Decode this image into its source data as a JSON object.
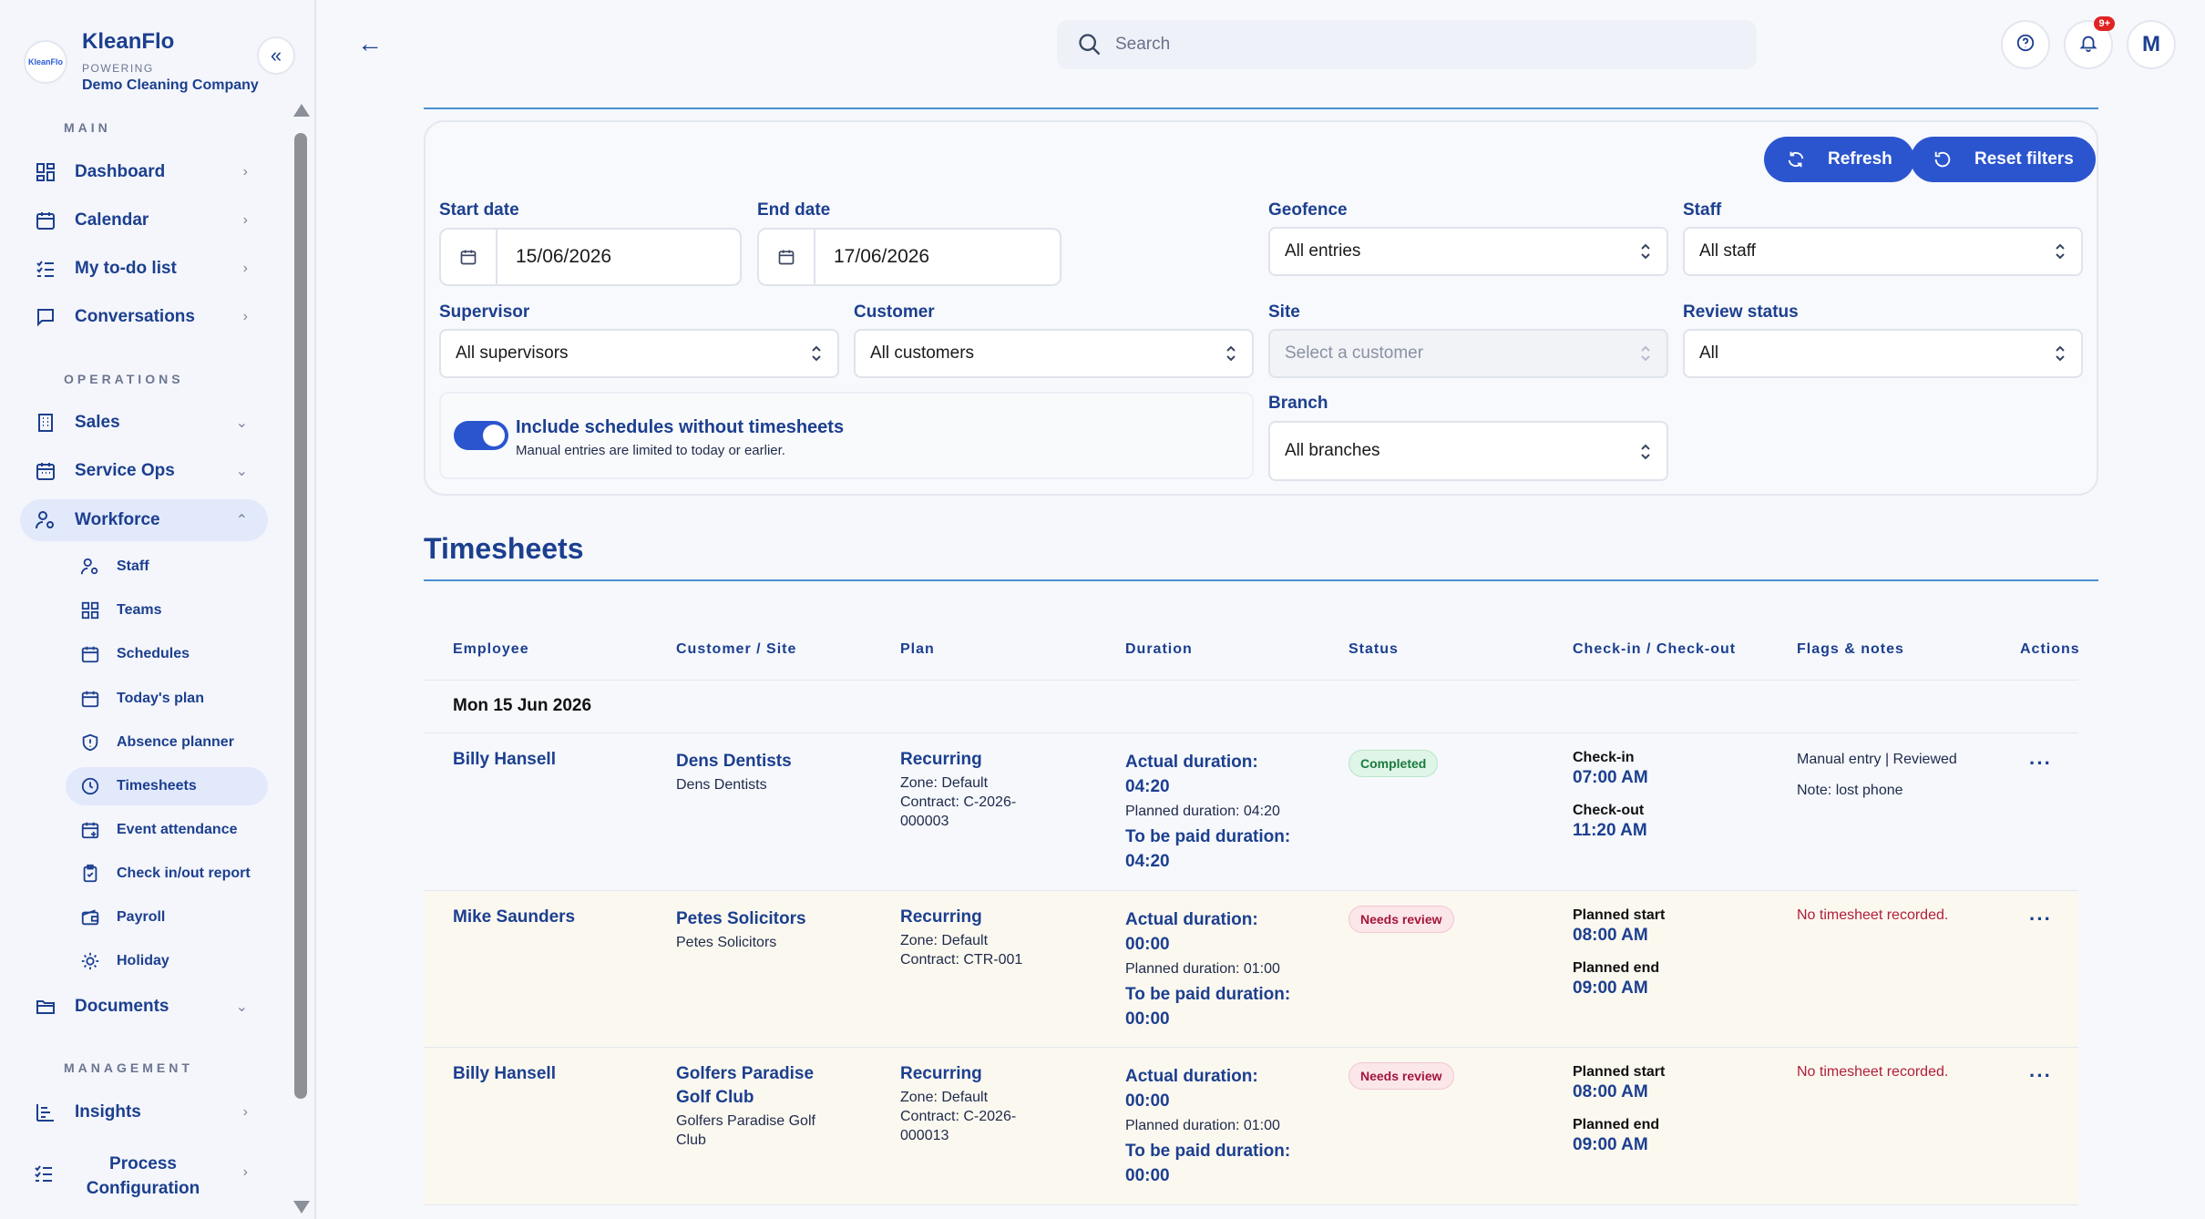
{
  "app": {
    "brand_name": "KleanFlo",
    "logo_text": "KleanFlo",
    "powering_label": "POWERING",
    "company_name": "Demo Cleaning Company"
  },
  "sidebar": {
    "sections": {
      "main": "MAIN",
      "operations": "OPERATIONS",
      "management": "MANAGEMENT"
    },
    "items": {
      "dashboard": "Dashboard",
      "calendar": "Calendar",
      "todo": "My to-do list",
      "conversations": "Conversations",
      "sales": "Sales",
      "service_ops": "Service Ops",
      "workforce": "Workforce",
      "documents": "Documents",
      "insights": "Insights",
      "process_configuration": "Process Configuration"
    },
    "workforce_sub": {
      "staff": "Staff",
      "teams": "Teams",
      "schedules": "Schedules",
      "todays_plan": "Today's plan",
      "absence_planner": "Absence planner",
      "timesheets": "Timesheets",
      "event_attendance": "Event attendance",
      "checkin_report": "Check in/out report",
      "payroll": "Payroll",
      "holiday": "Holiday"
    }
  },
  "topbar": {
    "search_placeholder": "Search",
    "notifications_badge": "9+",
    "avatar_initial": "M"
  },
  "filters": {
    "refresh_label": "Refresh",
    "reset_label": "Reset filters",
    "start_date_label": "Start date",
    "start_date_value": "15/06/2026",
    "end_date_label": "End date",
    "end_date_value": "17/06/2026",
    "geofence_label": "Geofence",
    "geofence_value": "All entries",
    "staff_label": "Staff",
    "staff_value": "All staff",
    "supervisor_label": "Supervisor",
    "supervisor_value": "All supervisors",
    "customer_label": "Customer",
    "customer_value": "All customers",
    "site_label": "Site",
    "site_placeholder": "Select a customer",
    "review_label": "Review status",
    "review_value": "All",
    "toggle_title": "Include schedules without timesheets",
    "toggle_sub": "Manual entries are limited to today or earlier.",
    "toggle_on": true,
    "branch_label": "Branch",
    "branch_value": "All branches"
  },
  "timesheets": {
    "title": "Timesheets",
    "columns": {
      "employee": "Employee",
      "customer_site": "Customer / Site",
      "plan": "Plan",
      "duration": "Duration",
      "status": "Status",
      "checkin": "Check-in / Check-out",
      "flags": "Flags & notes",
      "actions": "Actions"
    },
    "date_group": "Mon 15 Jun 2026",
    "rows": [
      {
        "employee": "Billy Hansell",
        "customer": "Dens Dentists",
        "site": "Dens Dentists",
        "plan_type": "Recurring",
        "zone": "Zone: Default",
        "contract": "Contract: C-2026-000003",
        "actual_label": "Actual duration:",
        "actual_value": "04:20",
        "planned": "Planned duration: 04:20",
        "paid_label": "To be paid duration:",
        "paid_value": "04:20",
        "status": "Completed",
        "ck1_label": "Check-in",
        "ck1_value": "07:00 AM",
        "ck2_label": "Check-out",
        "ck2_value": "11:20 AM",
        "flag1": "Manual entry | Reviewed",
        "flag2": "Note: lost phone",
        "actions": "···"
      },
      {
        "employee": "Mike Saunders",
        "customer": "Petes Solicitors",
        "site": "Petes Solicitors",
        "plan_type": "Recurring",
        "zone": "Zone: Default",
        "contract": "Contract: CTR-001",
        "actual_label": "Actual duration:",
        "actual_value": "00:00",
        "planned": "Planned duration: 01:00",
        "paid_label": "To be paid duration:",
        "paid_value": "00:00",
        "status": "Needs review",
        "ck1_label": "Planned start",
        "ck1_value": "08:00 AM",
        "ck2_label": "Planned end",
        "ck2_value": "09:00 AM",
        "flag1": "No timesheet recorded.",
        "actions": "···"
      },
      {
        "employee": "Billy Hansell",
        "customer": "Golfers Paradise Golf Club",
        "site": "Golfers Paradise Golf Club",
        "plan_type": "Recurring",
        "zone": "Zone: Default",
        "contract": "Contract: C-2026-000013",
        "actual_label": "Actual duration:",
        "actual_value": "00:00",
        "planned": "Planned duration: 01:00",
        "paid_label": "To be paid duration:",
        "paid_value": "00:00",
        "status": "Needs review",
        "ck1_label": "Planned start",
        "ck1_value": "08:00 AM",
        "ck2_label": "Planned end",
        "ck2_value": "09:00 AM",
        "flag1": "No timesheet recorded.",
        "actions": "···"
      }
    ]
  }
}
